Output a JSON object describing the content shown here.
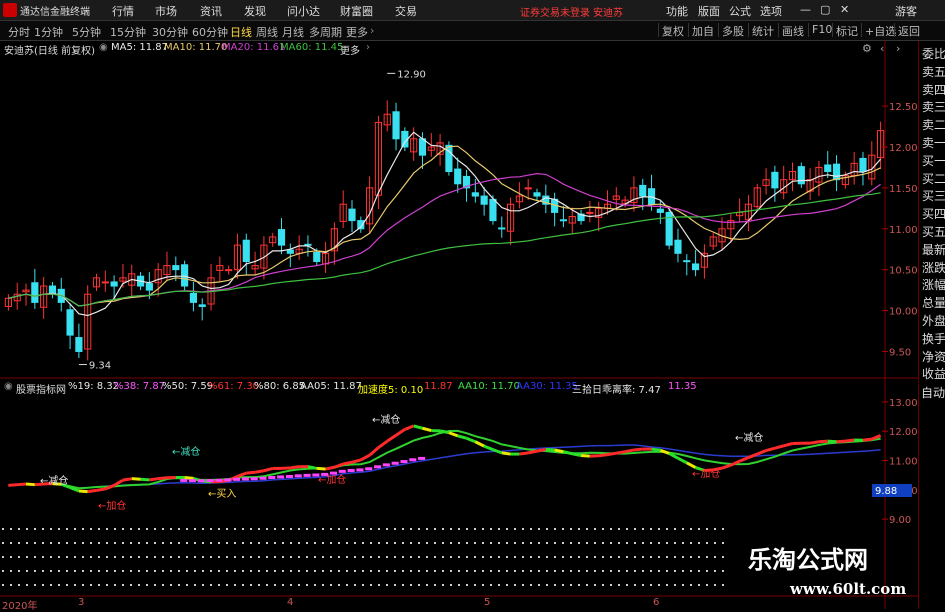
{
  "app": {
    "name": "通达信金融终端",
    "menu": [
      "行情",
      "市场",
      "资讯",
      "发现",
      "问小达",
      "财富圈",
      "交易"
    ],
    "warning": "证券交易未登录",
    "stock_name_top": "安迪苏",
    "right_menu": [
      "功能",
      "版面",
      "公式",
      "选项"
    ],
    "guest": "游客"
  },
  "toolbar": {
    "periods": [
      "分时",
      "1分钟",
      "5分钟",
      "15分钟",
      "30分钟",
      "60分钟",
      "日线",
      "周线",
      "月线",
      "多周期",
      "更多"
    ],
    "active_period": "日线",
    "right_buttons": [
      "复权",
      "加自",
      "多股",
      "统计",
      "画线",
      "F10",
      "标记",
      "+自选",
      "返回"
    ]
  },
  "main_chart": {
    "title": "安迪苏(日线 前复权)",
    "ma_legend": [
      {
        "label": "MA5: 11.87",
        "color": "#e8e8e8"
      },
      {
        "label": "MA10: 11.70",
        "color": "#e8c96b"
      },
      {
        "label": "MA20: 11.61",
        "color": "#d040d0"
      },
      {
        "label": "MA60: 11.45",
        "color": "#40c040"
      }
    ],
    "high_label": "12.90",
    "low_label": "9.34",
    "y_ticks": [
      "12.50",
      "12.00",
      "11.50",
      "11.00",
      "10.50",
      "10.00",
      "9.50"
    ],
    "ylim": [
      9.2,
      13.1
    ],
    "candle_up_color": "#ff3333",
    "candle_down_color": "#39e0f0"
  },
  "indicator": {
    "name": "股票指标网",
    "legend": [
      {
        "label": "%19: 8.32",
        "color": "#e8e8e8"
      },
      {
        "label": "%38: 7.87",
        "color": "#ff55ff"
      },
      {
        "label": "%50: 7.59",
        "color": "#e8e8e8"
      },
      {
        "label": "%61: 7.30",
        "color": "#ff3333"
      },
      {
        "label": "%80: 6.85",
        "color": "#e8e8e8"
      },
      {
        "label": "AA05: 11.87",
        "color": "#e8e8e8"
      },
      {
        "label": "加速度5: 0.10",
        "color": "#ffff00"
      },
      {
        "label": "11.87",
        "color": "#ff3333"
      },
      {
        "label": "AA10: 11.70",
        "color": "#40e040"
      },
      {
        "label": "AA30: 11.35",
        "color": "#3333ff"
      },
      {
        "label": "三拾日乖离率: 7.47",
        "color": "#e8e8e8"
      },
      {
        "label": "11.35",
        "color": "#ff55ff"
      }
    ],
    "y_ticks": [
      "13.00",
      "12.00",
      "11.00",
      "10.00",
      "9.00"
    ],
    "current_value": "9.88",
    "annotations": [
      {
        "text": "←减仓",
        "color": "#e8e8e8"
      },
      {
        "text": "←加仓",
        "color": "#ff3333"
      },
      {
        "text": "←减仓",
        "color": "#40e0c0"
      },
      {
        "text": "←买入",
        "color": "#ffd84a"
      },
      {
        "text": "←加仓",
        "color": "#ff3333"
      },
      {
        "text": "←减仓",
        "color": "#e8e8e8"
      },
      {
        "text": "←加仓",
        "color": "#ff3333"
      },
      {
        "text": "←减仓",
        "color": "#e8e8e8"
      }
    ]
  },
  "right_panel": {
    "items": [
      "委比",
      "卖五",
      "卖四",
      "卖三",
      "卖二",
      "卖一",
      "买一",
      "买二",
      "买三",
      "买四",
      "买五",
      "最新",
      "涨跌",
      "涨幅",
      "总量",
      "外盘",
      "换手",
      "净资",
      "收益"
    ],
    "auto": "自动"
  },
  "dates": [
    "2020年",
    "3",
    "4",
    "5",
    "6"
  ],
  "watermark": {
    "main": "乐淘公式网",
    "sub": "www.60lt.com"
  }
}
